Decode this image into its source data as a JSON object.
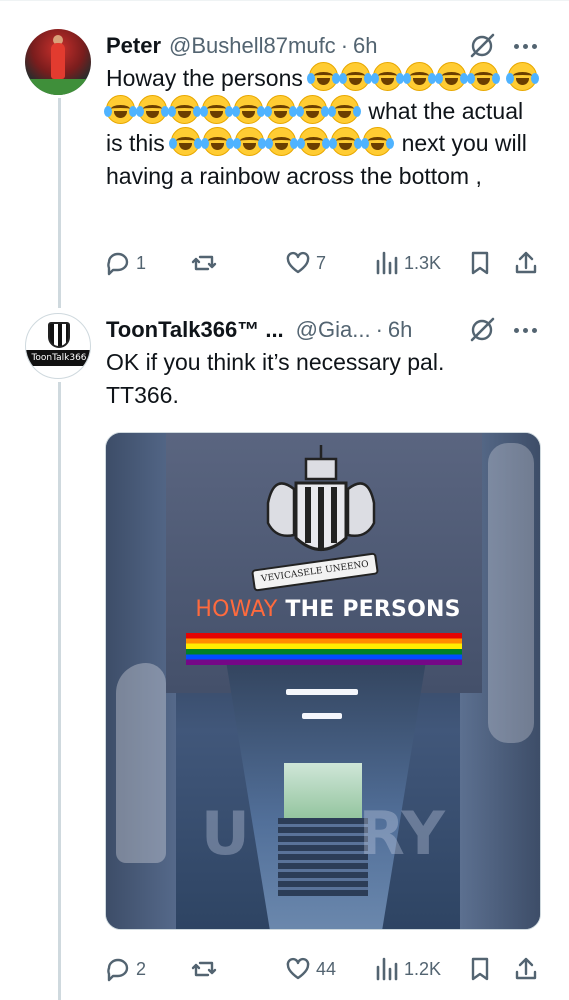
{
  "tweets": [
    {
      "author": "Peter",
      "handle": "@Bushell87mufc",
      "separator": "·",
      "time": "6h",
      "text": {
        "part1": "Howay the persons",
        "part2": "what the actual is this",
        "part3": "next you will having a rainbow across the bottom ,"
      },
      "emoji_name": "face-with-tears-of-joy",
      "stats": {
        "replies": "1",
        "reposts": "",
        "likes": "7",
        "views": "1.3K"
      }
    },
    {
      "author": "ToonTalk366™ ...",
      "handle": "@Gia...",
      "separator": "·",
      "time": "6h",
      "avatar_label": "ToonTalk366",
      "ribbon_text": "VEVICASELE UNEENO",
      "text": "OK if you think it’s necessary pal. TT366.",
      "media": {
        "banner_highlight": "HOWAY",
        "banner_rest": " THE PERSONS"
      },
      "stats": {
        "replies": "2",
        "reposts": "",
        "likes": "44",
        "views": "1.2K"
      }
    }
  ],
  "colors": {
    "text": "#0f1419",
    "secondary": "#536471",
    "thread_line": "#cfd9de"
  }
}
